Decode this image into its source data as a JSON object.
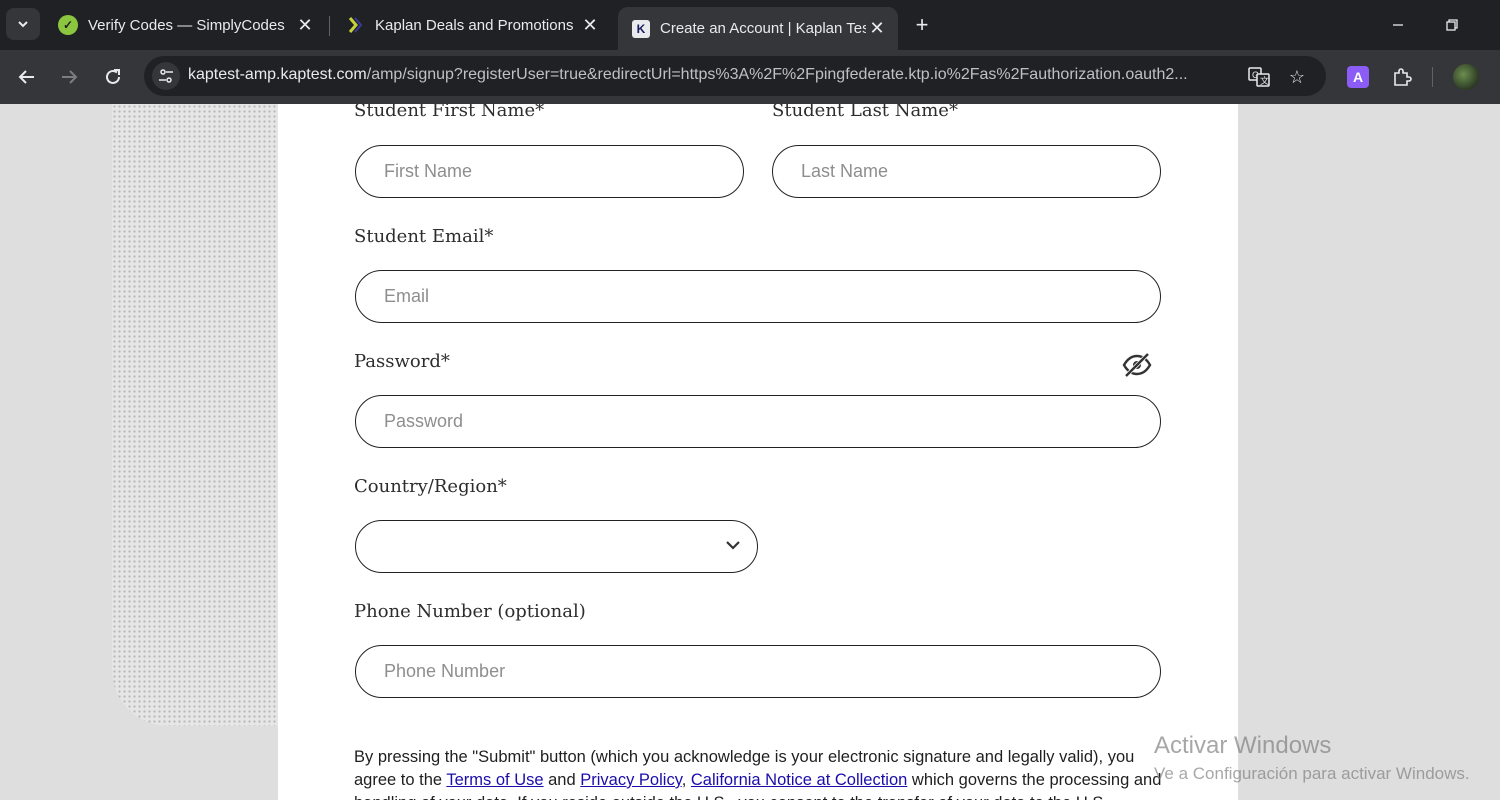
{
  "tabs": [
    {
      "title": "Verify Codes — SimplyCodes",
      "favicon": "simplycodes-icon"
    },
    {
      "title": "Kaplan Deals and Promotions",
      "favicon": "kaplan-leaf-icon"
    },
    {
      "title": "Create an Account | Kaplan Test",
      "favicon": "kaplan-k-icon",
      "active": true
    }
  ],
  "browser": {
    "url_domain": "kaptest-amp.kaptest.com",
    "url_path": "/amp/signup?registerUser=true&redirectUrl=https%3A%2F%2Fpingfederate.ktp.io%2Fas%2Fauthorization.oauth2..."
  },
  "form": {
    "first_name_label": "Student First Name*",
    "first_name_placeholder": "First Name",
    "last_name_label": "Student Last Name*",
    "last_name_placeholder": "Last Name",
    "email_label": "Student Email*",
    "email_placeholder": "Email",
    "password_label": "Password*",
    "password_placeholder": "Password",
    "country_label": "Country/Region*",
    "country_value": "",
    "phone_label": "Phone Number (optional)",
    "phone_placeholder": "Phone Number"
  },
  "disclaimer": {
    "text1": "By pressing the \"Submit\" button (which you acknowledge is your electronic signature and legally valid), you agree to the ",
    "terms_link": "Terms of Use",
    "and": " and ",
    "privacy_link": "Privacy Policy",
    "comma": ", ",
    "california_link": "California Notice at Collection",
    "text2": " which governs the processing and handling of your data. If you reside outside the U.S., you consent to the transfer of your data to the U.S."
  },
  "watermark": {
    "line1": "Activar Windows",
    "line2": "Ve a Configuración para activar Windows."
  },
  "colors": {
    "link": "#1a0dab",
    "chrome_dark": "#202124",
    "chrome_toolbar": "#35363a"
  }
}
